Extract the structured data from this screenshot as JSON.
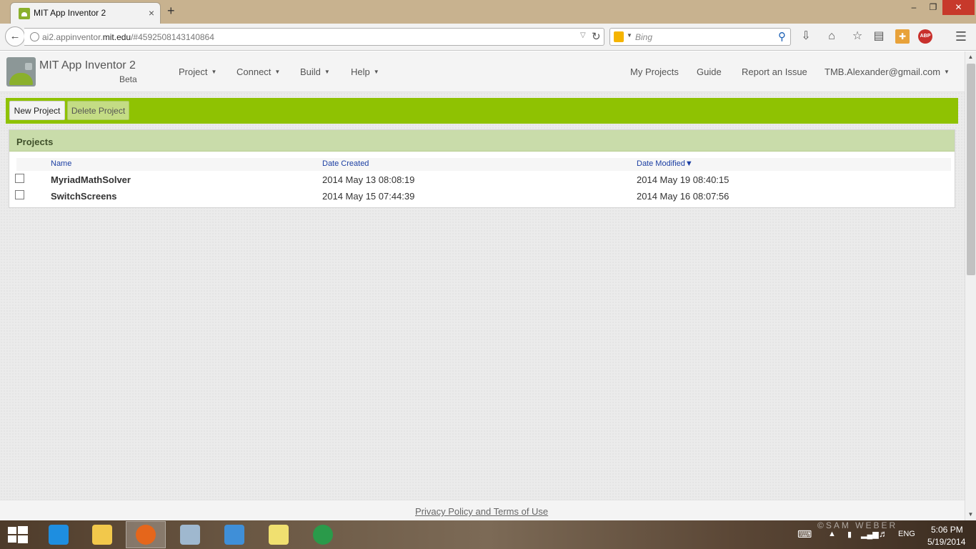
{
  "browser": {
    "tab_title": "MIT App Inventor 2",
    "tab_close": "×",
    "new_tab": "+",
    "url_prefix": "ai2.appinventor.",
    "url_domain": "mit.edu",
    "url_suffix": "/#4592508143140864",
    "search_placeholder": "Bing",
    "window_buttons": {
      "minimize": "‒",
      "maximize": "❐",
      "close": "✕"
    }
  },
  "app": {
    "title": "MIT App Inventor 2",
    "subtitle": "Beta",
    "menus": [
      {
        "label": "Project"
      },
      {
        "label": "Connect"
      },
      {
        "label": "Build"
      },
      {
        "label": "Help"
      }
    ],
    "right_links": {
      "my_projects": "My Projects",
      "guide": "Guide",
      "report_issue": "Report an Issue",
      "account": "TMB.Alexander@gmail.com"
    }
  },
  "toolbar": {
    "new_project": "New Project",
    "delete_project": "Delete Project"
  },
  "projects": {
    "title": "Projects",
    "columns": {
      "name": "Name",
      "date_created": "Date Created",
      "date_modified": "Date Modified▼"
    },
    "rows": [
      {
        "name": "MyriadMathSolver",
        "created": "2014 May 13 08:08:19",
        "modified": "2014 May 19 08:40:15",
        "checked": false
      },
      {
        "name": "SwitchScreens",
        "created": "2014 May 15 07:44:39",
        "modified": "2014 May 16 08:07:56",
        "checked": false
      }
    ]
  },
  "footer": {
    "privacy_link": "Privacy Policy and Terms of Use"
  },
  "taskbar": {
    "apps": [
      {
        "icon": "internet-explorer-icon",
        "color": "#1e8ee0"
      },
      {
        "icon": "file-explorer-icon",
        "color": "#f2c84b"
      },
      {
        "icon": "firefox-icon",
        "color": "#e5661b",
        "active": true
      },
      {
        "icon": "task-manager-icon",
        "color": "#9fb8cf"
      },
      {
        "icon": "remote-desktop-icon",
        "color": "#3f8fd8"
      },
      {
        "icon": "sticky-notes-icon",
        "color": "#f0e070"
      },
      {
        "icon": "globe-app-icon",
        "color": "#2a9a4a"
      }
    ],
    "language": "ENG",
    "time": "5:06 PM",
    "date": "5/19/2014",
    "watermark": "©SAM WEBER"
  }
}
